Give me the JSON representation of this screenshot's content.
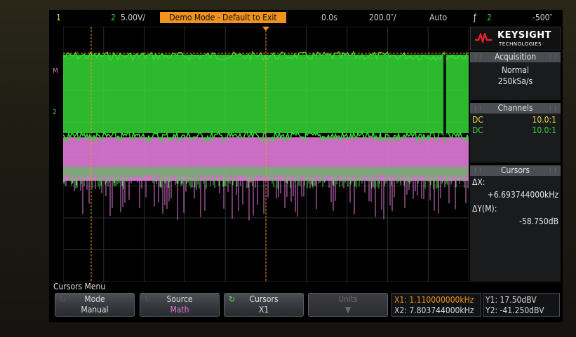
{
  "topbar": {
    "ch1": "1",
    "ch2": "2",
    "vdiv": "5.00V/",
    "demo": "Demo Mode - Default to Exit",
    "tpos": "0.0s",
    "tdiv": "200.0″/",
    "trigmode": "Auto",
    "trig_icon": "ƒ",
    "trig_ch": "2",
    "trig_level": "-500″"
  },
  "markers": {
    "math": "M",
    "ch2": "2"
  },
  "logo": {
    "brand": "KEYSIGHT",
    "sub": "TECHNOLOGIES"
  },
  "acquisition": {
    "title": "Acquisition",
    "mode": "Normal",
    "rate": "250kSa/s"
  },
  "channels": {
    "title": "Channels",
    "rows": [
      {
        "coupling": "DC",
        "probe": "10.0:1",
        "color": "#e8d84a"
      },
      {
        "coupling": "DC",
        "probe": "10.0:1",
        "color": "#35d935"
      }
    ]
  },
  "cursors_panel": {
    "title": "Cursors",
    "dx_label": "ΔX:",
    "dx_value": "+6.693744000kHz",
    "dy_label": "ΔY(M):",
    "dy_value": "-58.750dB"
  },
  "menu": {
    "title": "Cursors Menu",
    "keys": [
      {
        "label": "Mode",
        "value": "Manual"
      },
      {
        "label": "Source",
        "value": "Math"
      },
      {
        "label": "Cursors",
        "value": "X1"
      },
      {
        "label": "Units",
        "value": ""
      }
    ]
  },
  "readouts": {
    "x1": "X1: 1.110000000kHz",
    "x2": "X2: 7.803744000kHz",
    "y1": "Y1: 17.50dBV",
    "y2": "Y2: -41.250dBV"
  },
  "colors": {
    "ch1": "#e8d84a",
    "ch2": "#35d935",
    "math": "#e07ad8",
    "cursor": "#f0921c",
    "demo_bg": "#f0921c"
  }
}
